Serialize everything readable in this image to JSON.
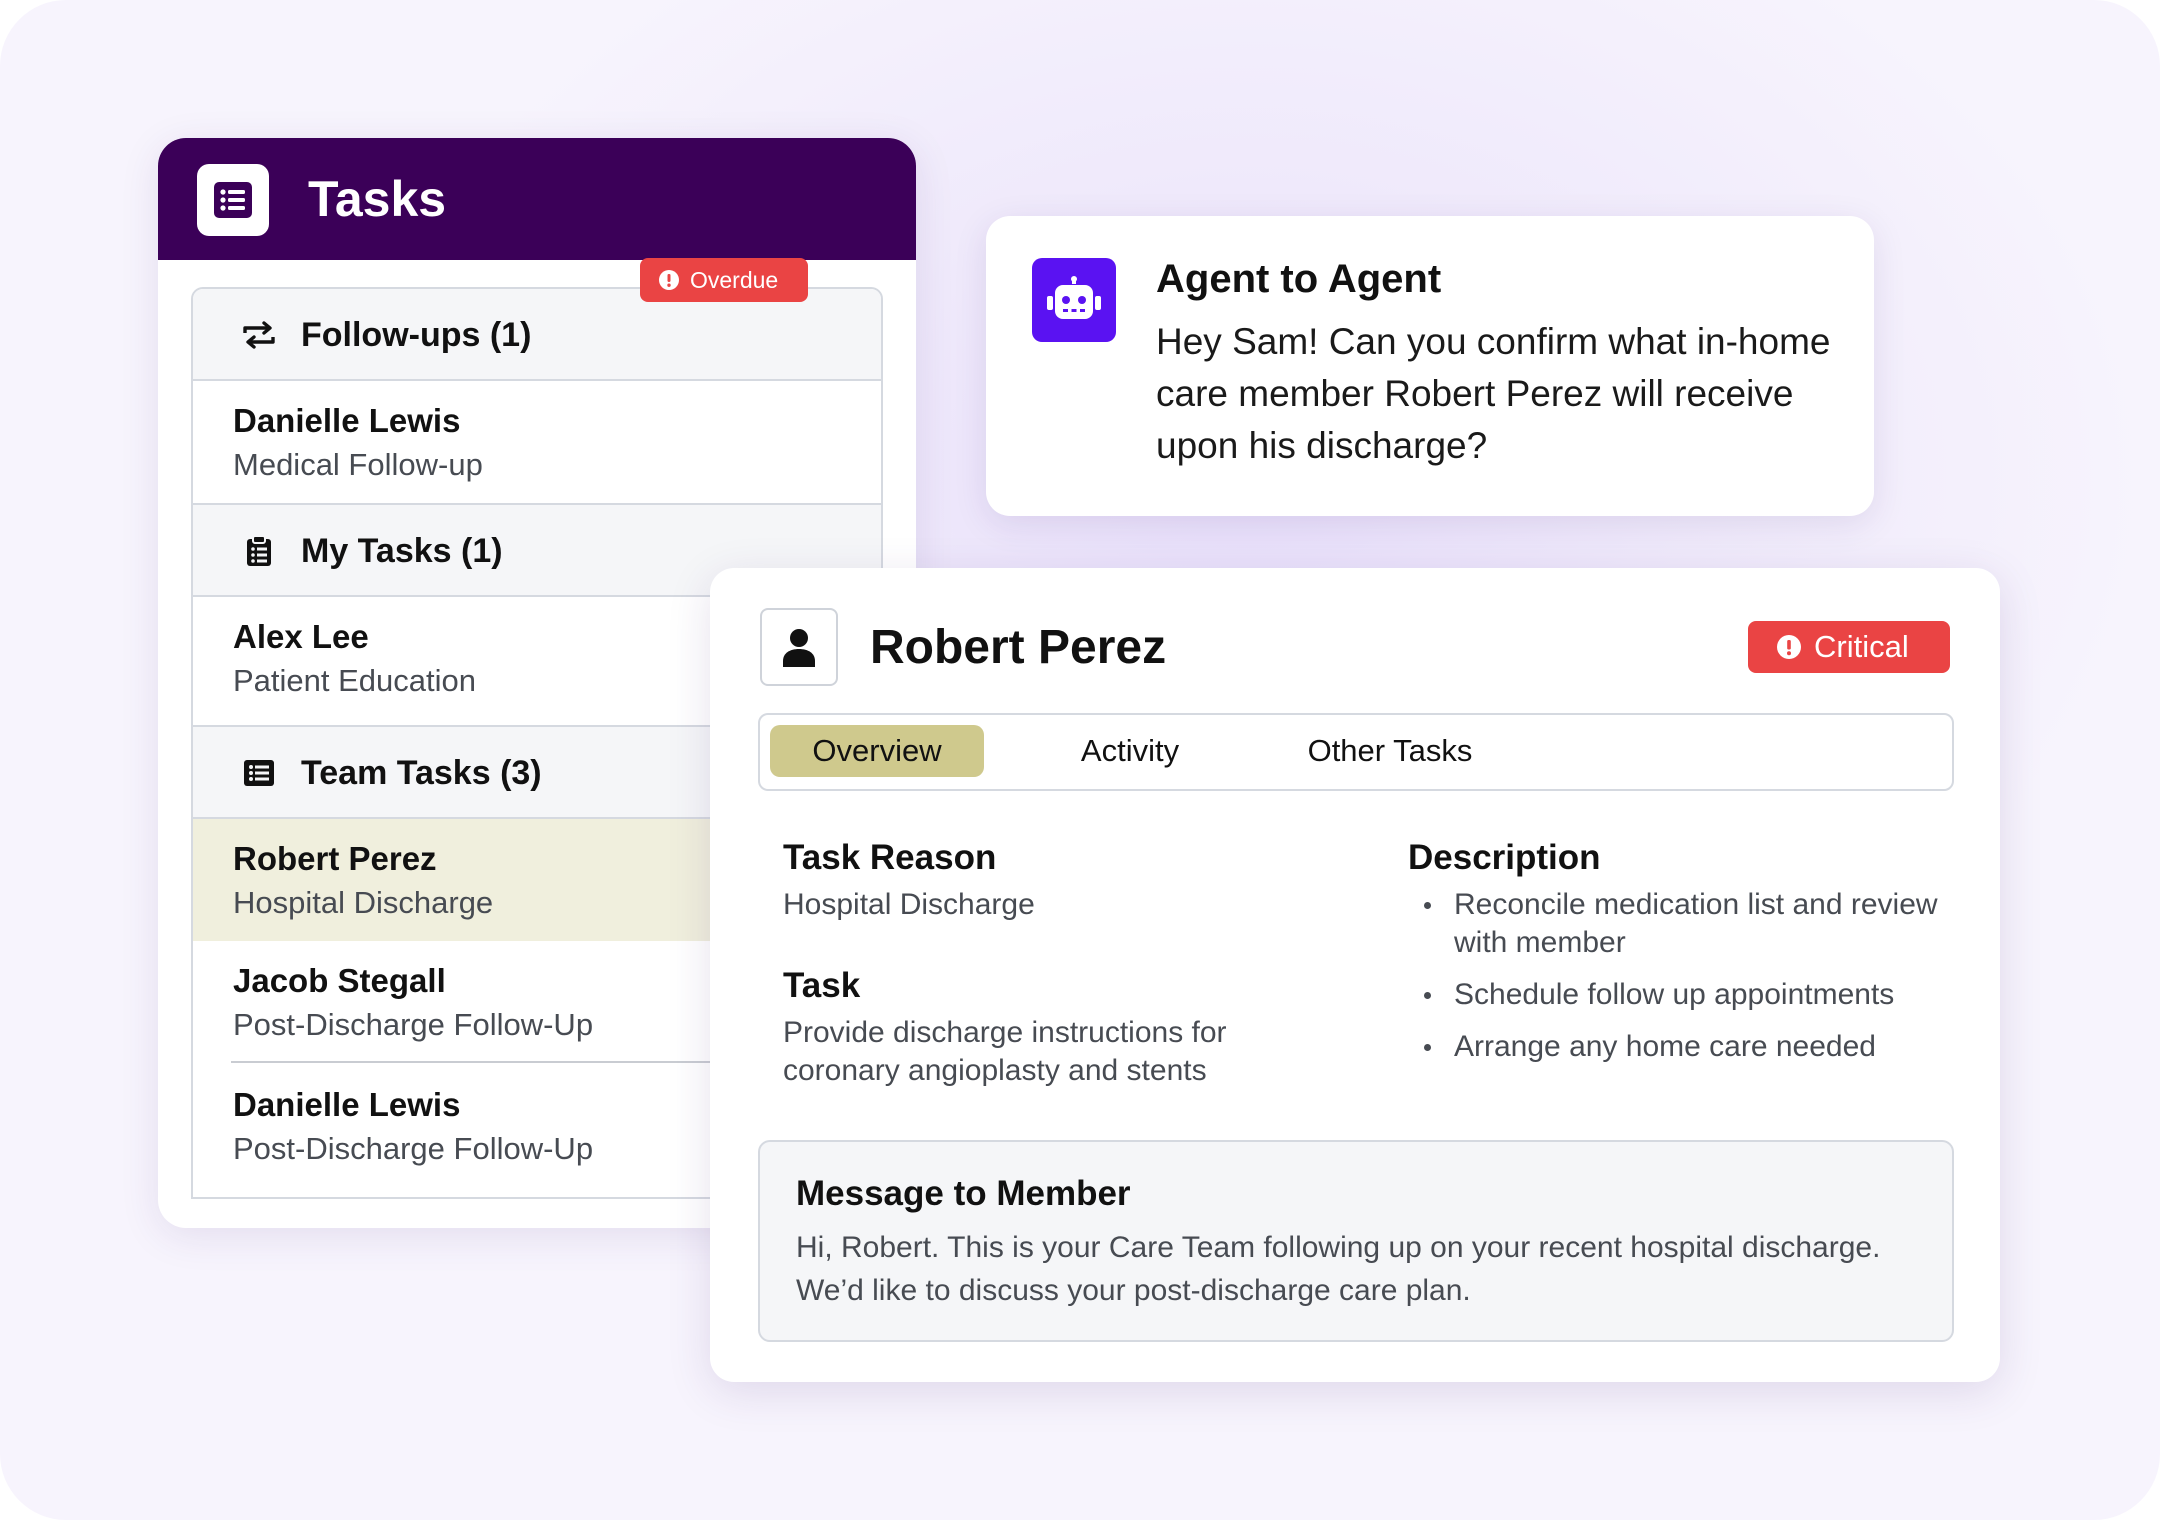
{
  "tasks_panel": {
    "title": "Tasks",
    "sections": [
      {
        "label": "Follow-ups (1)",
        "icon": "repeat-icon",
        "items": [
          {
            "name": "Danielle Lewis",
            "subtitle": "Medical Follow-up",
            "badge": "Overdue"
          }
        ]
      },
      {
        "label": "My Tasks (1)",
        "icon": "clipboard-icon",
        "items": [
          {
            "name": "Alex Lee",
            "subtitle": "Patient Education"
          }
        ]
      },
      {
        "label": "Team Tasks (3)",
        "icon": "list-icon",
        "items": [
          {
            "name": "Robert Perez",
            "subtitle": "Hospital Discharge",
            "selected": true
          },
          {
            "name": "Jacob Stegall",
            "subtitle": "Post-Discharge Follow-Up"
          },
          {
            "name": "Danielle Lewis",
            "subtitle": "Post-Discharge Follow-Up"
          }
        ]
      }
    ]
  },
  "agent_card": {
    "title": "Agent to Agent",
    "message": "Hey Sam! Can you confirm what in-home care member Robert Perez will receive upon his discharge?",
    "icon": "robot-icon"
  },
  "detail": {
    "name": "Robert Perez",
    "badge": "Critical",
    "tabs": [
      "Overview",
      "Activity",
      "Other Tasks"
    ],
    "active_tab": "Overview",
    "task_reason_label": "Task Reason",
    "task_reason": "Hospital Discharge",
    "task_label": "Task",
    "task": "Provide discharge instructions for coronary angioplasty and stents",
    "description_label": "Description",
    "description": [
      "Reconcile medication list and review with member",
      "Schedule follow up appointments",
      "Arrange any home care needed"
    ],
    "message_title": "Message to Member",
    "message": "Hi, Robert. This is your Care Team following up on your recent hospital discharge. We’d like to discuss your post-discharge care plan."
  },
  "colors": {
    "header_purple": "#3b0058",
    "agent_purple": "#5a12f2",
    "badge_red": "#ea4444",
    "selected_row": "#f0efdd",
    "active_tab": "#cfc98d"
  }
}
